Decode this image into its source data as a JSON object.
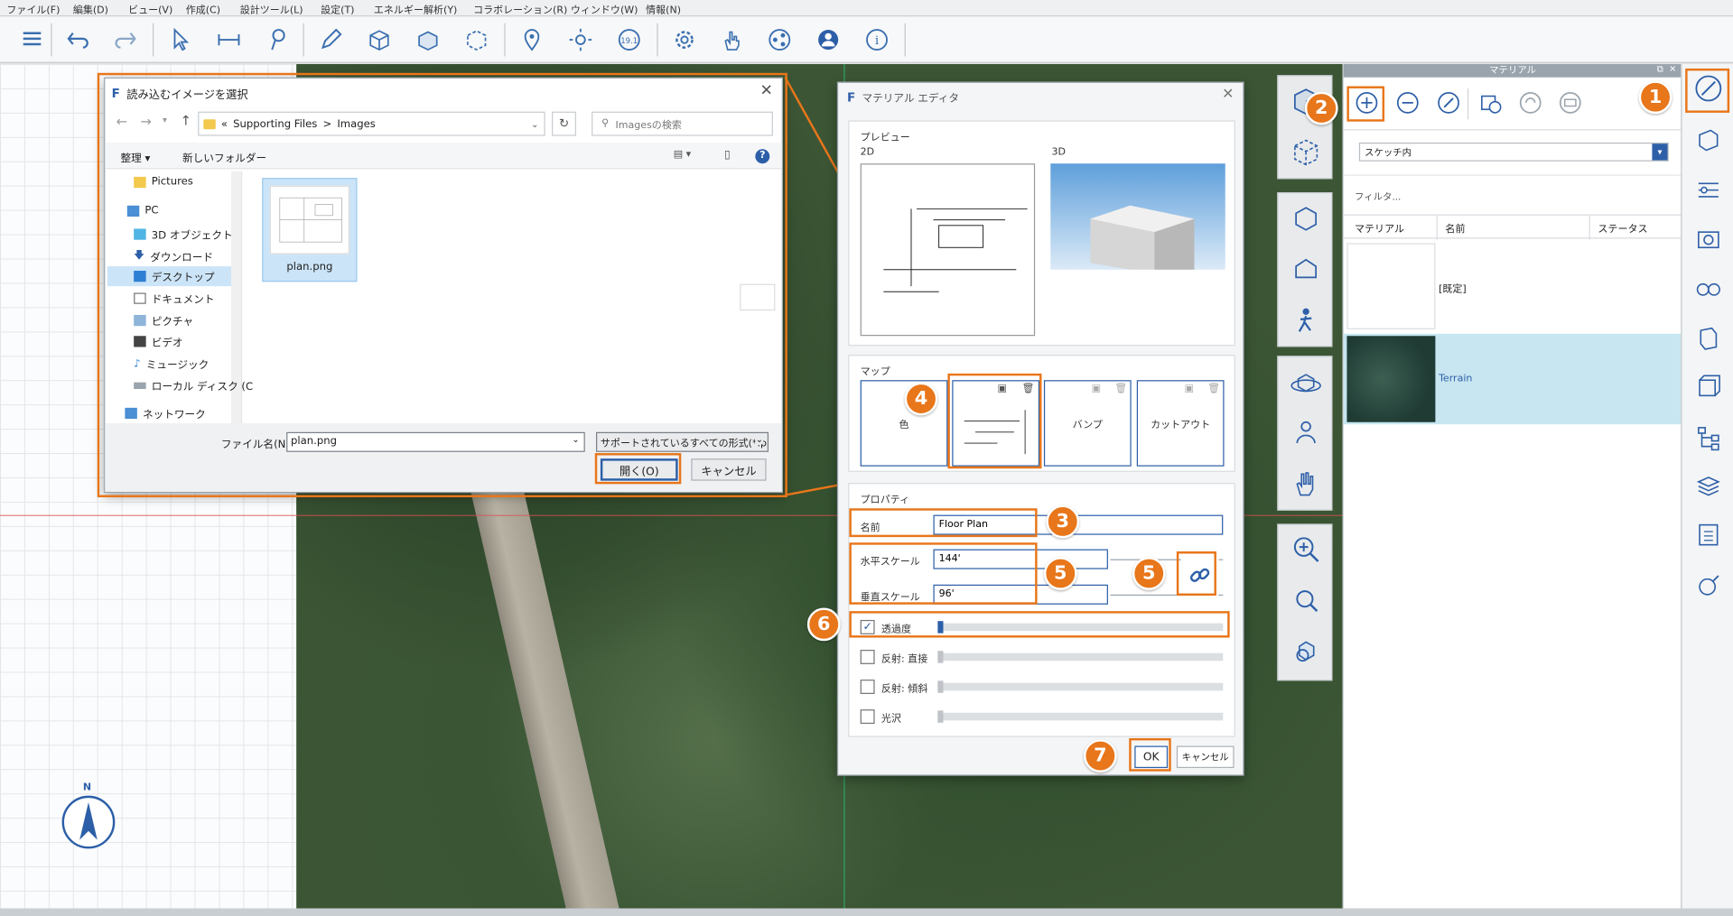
{
  "menu": [
    "ファイル(F)",
    "編集(D)",
    "ビュー(V)",
    "作成(C)",
    "設計ツール(L)",
    "設定(T)",
    "エネルギー解析(Y)",
    "コラボレーション(R)",
    "ウィンドウ(W)",
    "情報(N)"
  ],
  "file_dialog": {
    "title": "読み込むイメージを選択",
    "path_prefix": "«",
    "path_parts": [
      "Supporting Files",
      "Images"
    ],
    "path_sep": ">",
    "search_placeholder": "Imagesの検索",
    "organize": "整理",
    "new_folder": "新しいフォルダー",
    "tree": [
      "Pictures",
      "PC",
      "3D オブジェクト",
      "ダウンロード",
      "デスクトップ",
      "ドキュメント",
      "ピクチャ",
      "ビデオ",
      "ミュージック",
      "ローカル ディスク (C",
      "ネットワーク"
    ],
    "file_name": "plan.png",
    "filename_label": "ファイル名(N):",
    "filename_value": "plan.png",
    "filter_value": "サポートされているすべての形式(*.p",
    "open_button": "開く(O)",
    "cancel_button": "キャンセル"
  },
  "material_editor": {
    "title": "マテリアル エディタ",
    "preview_label": "プレビュー",
    "label_2d": "2D",
    "label_3d": "3D",
    "map_label": "マップ",
    "maps": [
      "色",
      "",
      "バンプ",
      "カットアウト"
    ],
    "properties_label": "プロパティ",
    "name_label": "名前",
    "name_value": "Floor Plan",
    "hscale_label": "水平スケール",
    "hscale_value": "144'",
    "vscale_label": "垂直スケール",
    "vscale_value": "96'",
    "sliders": [
      {
        "label": "透過度",
        "checked": true
      },
      {
        "label": "反射: 直接",
        "checked": false
      },
      {
        "label": "反射: 傾斜",
        "checked": false
      },
      {
        "label": "光沢",
        "checked": false
      }
    ],
    "ok_button": "OK",
    "cancel_button": "キャンセル"
  },
  "material_panel": {
    "title": "マテリアル",
    "dropdown_value": "スケッチ内",
    "filter_placeholder": "フィルタ...",
    "columns": [
      "マテリアル",
      "名前",
      "ステータス"
    ],
    "rows": [
      {
        "name": "[既定]",
        "selected": false
      },
      {
        "name": "Terrain",
        "selected": true
      }
    ]
  },
  "badges": [
    "1",
    "2",
    "3",
    "4",
    "5",
    "5",
    "6",
    "7"
  ],
  "compass_label": "N",
  "colors": {
    "accent": "#e8761a",
    "selection": "#c7e6f1",
    "link_blue": "#2d5fa8"
  }
}
